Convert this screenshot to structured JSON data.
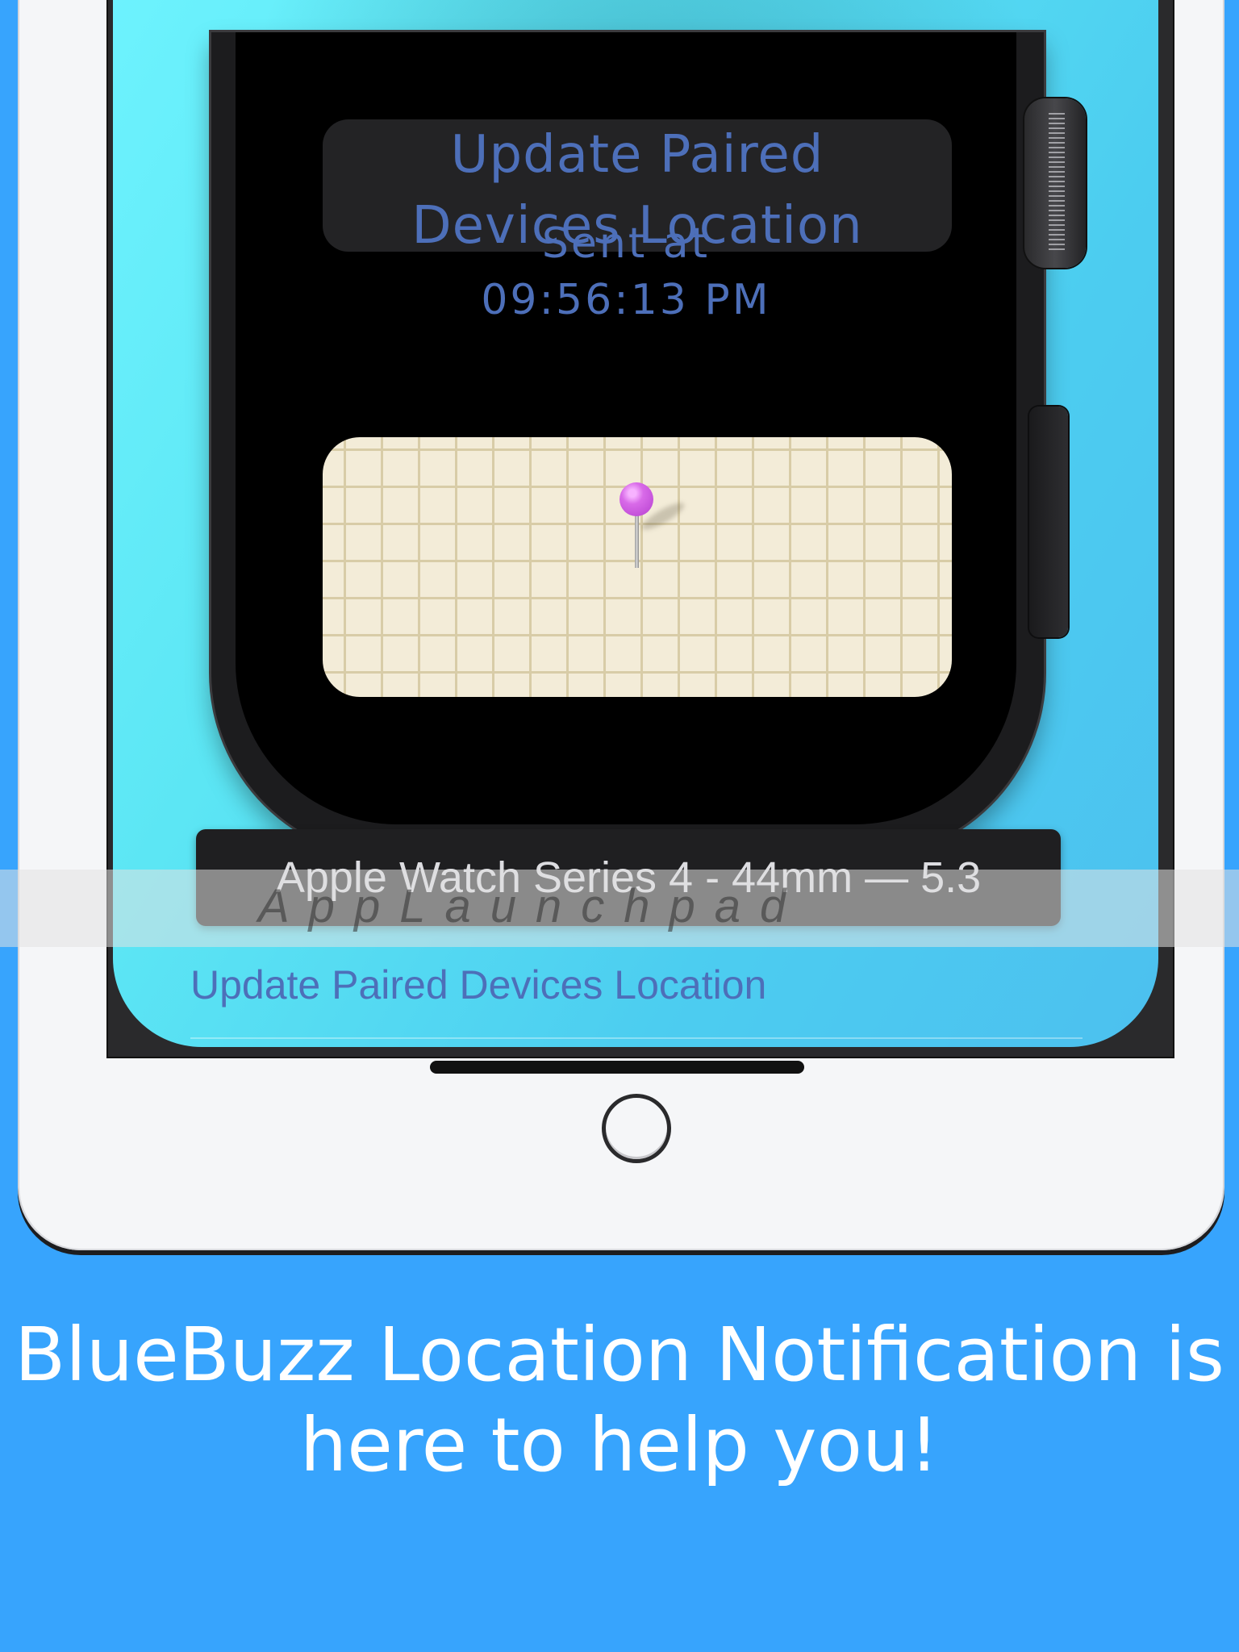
{
  "watch": {
    "action_button": "Update Paired\nDevices Location",
    "action_button_line1": "Update Paired",
    "action_button_line2": "Devices Location",
    "sent_label": "Sent at",
    "sent_time": "09:56:13 PM",
    "map_pin_color": "#cf5fe4"
  },
  "device_caption": "Apple Watch Series 4 - 44mm — 5.3",
  "watermark": "AppLaunchpad",
  "phone": {
    "update_link": "Update Paired Devices Location"
  },
  "headline": {
    "line1": "BlueBuzz Location Notification is",
    "line2": "here to help you!"
  },
  "colors": {
    "background": "#37a4fd",
    "accent_text": "#4d6fb9",
    "headline_text": "#ffffff"
  }
}
